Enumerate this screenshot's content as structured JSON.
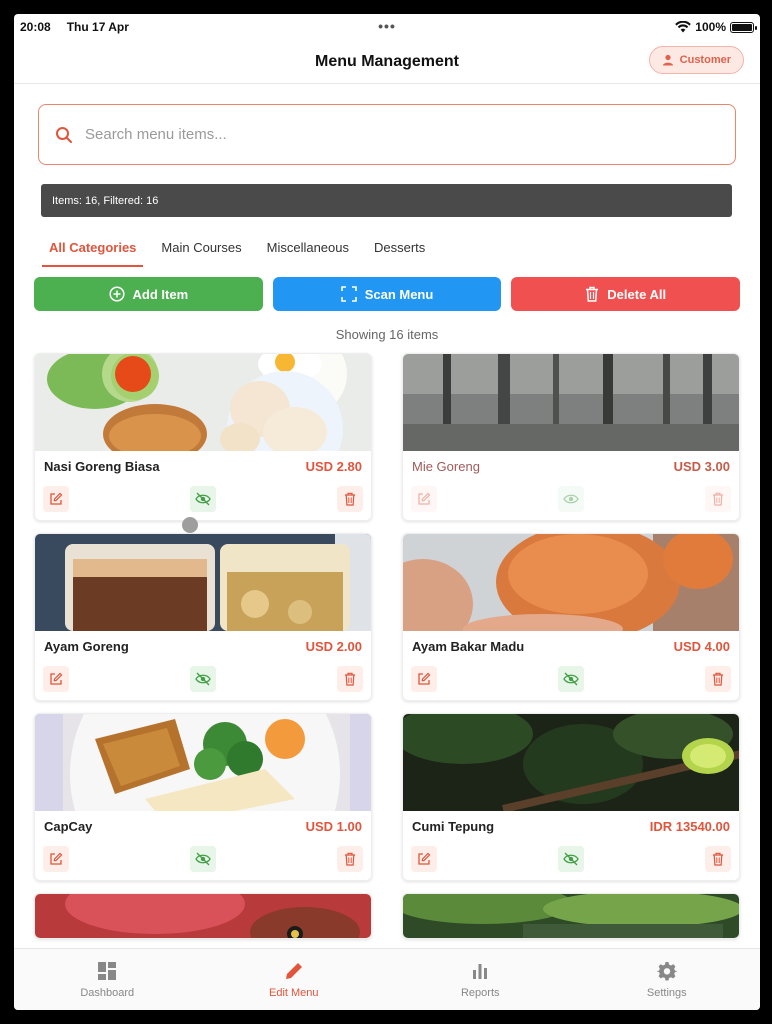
{
  "status": {
    "time": "20:08",
    "date": "Thu 17 Apr",
    "battery": "100%"
  },
  "header": {
    "title": "Menu Management",
    "customer_label": "Customer"
  },
  "search": {
    "placeholder": "Search menu items..."
  },
  "info": {
    "text": "Items: 16, Filtered: 16"
  },
  "tabs": [
    "All Categories",
    "Main Courses",
    "Miscellaneous",
    "Desserts"
  ],
  "actions": {
    "add": "Add Item",
    "scan": "Scan Menu",
    "delete_all": "Delete All"
  },
  "showing": "Showing 16 items",
  "items": [
    {
      "name": "Nasi Goreng Biasa",
      "price": "USD 2.80"
    },
    {
      "name": "Mie Goreng",
      "price": "USD 3.00"
    },
    {
      "name": "Ayam Goreng",
      "price": "USD 2.00"
    },
    {
      "name": "Ayam Bakar Madu",
      "price": "USD 4.00"
    },
    {
      "name": "CapCay",
      "price": "USD 1.00"
    },
    {
      "name": "Cumi Tepung",
      "price": "IDR 13540.00"
    }
  ],
  "nav": {
    "dashboard": "Dashboard",
    "edit_menu": "Edit Menu",
    "reports": "Reports",
    "settings": "Settings"
  },
  "colors": {
    "accent": "#e0553c",
    "add": "#4caf50",
    "scan": "#2196f3",
    "delete": "#f15050"
  }
}
